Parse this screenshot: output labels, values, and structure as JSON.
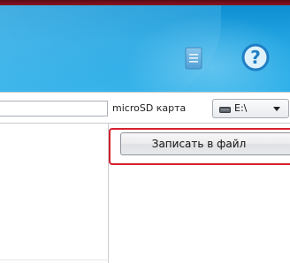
{
  "header": {
    "icons": {
      "document": "document-icon",
      "help": "help-icon"
    },
    "help_glyph": "?"
  },
  "toolbar": {
    "storage_label": "microSD карта",
    "drive_select": {
      "selected": "E:\\",
      "icon": "drive-icon"
    }
  },
  "main": {
    "write_button_label": "Записать в файл"
  },
  "colors": {
    "header_blue": "#24a6e3",
    "frame_dark_red": "#8a1422",
    "highlight_red": "#d6202e",
    "doc_icon_blue": "#4f9fd6",
    "help_icon_blue": "#1f7ec4"
  }
}
